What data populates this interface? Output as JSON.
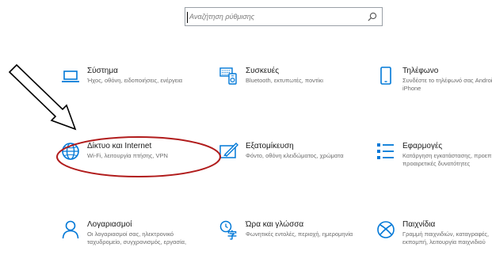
{
  "search": {
    "placeholder": "Αναζήτηση ρύθμισης"
  },
  "colors": {
    "accent": "#0078d7",
    "annotation_ellipse": "#b11c1c",
    "annotation_arrow": "#000000"
  },
  "tiles": [
    {
      "icon": "laptop-icon",
      "title": "Σύστημα",
      "description": "Ήχος, οθόνη, ειδοποιήσεις, ενέργεια"
    },
    {
      "icon": "devices-icon",
      "title": "Συσκευές",
      "description": "Bluetooth, εκτυπωτές, ποντίκι"
    },
    {
      "icon": "phone-icon",
      "title": "Τηλέφωνο",
      "description": "Συνδέστε το τηλέφωνό σας Android ή iPhone"
    },
    {
      "icon": "globe-icon",
      "title": "Δίκτυο και Internet",
      "description": "Wi-Fi, λειτουργία πτήσης, VPN"
    },
    {
      "icon": "personalization-icon",
      "title": "Εξατομίκευση",
      "description": "Φόντο, οθόνη κλειδώματος, χρώματα"
    },
    {
      "icon": "apps-icon",
      "title": "Εφαρμογές",
      "description": "Κατάργηση εγκατάστασης, προεπιλογές, προαιρετικές δυνατότητες"
    },
    {
      "icon": "person-icon",
      "title": "Λογαριασμοί",
      "description": "Οι λογαριασμοί σας, ηλεκτρονικό ταχυδρομείο, συγχρονισμός, εργασία,"
    },
    {
      "icon": "time-language-icon",
      "title": "Ώρα και γλώσσα",
      "description": "Φωνητικές εντολές, περιοχή, ημερομηνία"
    },
    {
      "icon": "xbox-icon",
      "title": "Παιχνίδια",
      "description": "Γραμμή παιχνιδιών, καταγραφές, εκπομπή, λειτουργία παιχνιδιού"
    }
  ]
}
